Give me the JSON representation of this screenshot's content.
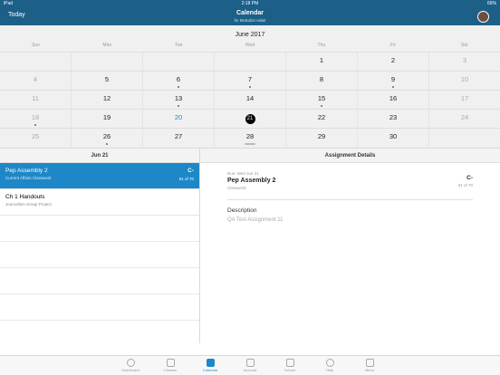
{
  "status": {
    "carrier": "iPad",
    "time": "2:18 PM",
    "battery": "66%"
  },
  "nav": {
    "left": "Today",
    "title": "Calendar",
    "subtitle": "for Brandon Adair"
  },
  "calendar": {
    "month": "June 2017",
    "dow": [
      "Sun",
      "Mon",
      "Tue",
      "Wed",
      "Thu",
      "Fri",
      "Sat"
    ],
    "weeks": [
      [
        "",
        "",
        "",
        "",
        "1",
        "2",
        "3"
      ],
      [
        "4",
        "5",
        "6",
        "7",
        "8",
        "9",
        "10"
      ],
      [
        "11",
        "12",
        "13",
        "14",
        "15",
        "16",
        "17"
      ],
      [
        "18",
        "19",
        "20",
        "21",
        "22",
        "23",
        "24"
      ],
      [
        "25",
        "26",
        "27",
        "28",
        "29",
        "30",
        ""
      ]
    ]
  },
  "list": {
    "header": "Jun 21",
    "items": [
      {
        "title": "Pep Assembly 2",
        "subtitle": "Current Affairs Classwork",
        "grade": "C-",
        "fraction": "51 of 70"
      },
      {
        "title": "Ch 1 Handouts",
        "subtitle": "Journalism Group Project",
        "grade": "",
        "fraction": ""
      }
    ]
  },
  "details": {
    "header": "Assignment Details",
    "due": "Due: Wed Jun 21",
    "name": "Pep Assembly 2",
    "category": "Classwork",
    "grade": "C-",
    "fraction": "51 of 70",
    "description_label": "Description",
    "description": "QA Test Assignment 11"
  },
  "tabs": [
    {
      "label": "Dashboard",
      "icon": "dashboard-icon"
    },
    {
      "label": "Classes",
      "icon": "classes-icon"
    },
    {
      "label": "Calendar",
      "icon": "calendar-icon"
    },
    {
      "label": "Account",
      "icon": "account-icon"
    },
    {
      "label": "School",
      "icon": "school-icon"
    },
    {
      "label": "Help",
      "icon": "help-icon"
    },
    {
      "label": "Menu",
      "icon": "menu-icon"
    }
  ]
}
